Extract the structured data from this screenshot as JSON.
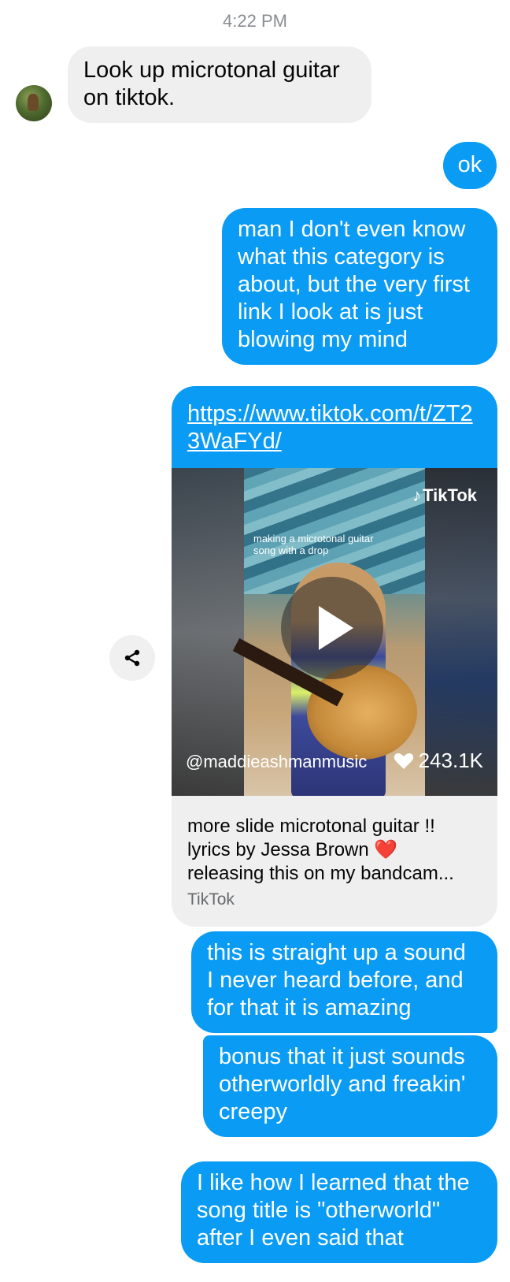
{
  "timestamp": "4:22 PM",
  "messages": {
    "m1": "Look up microtonal guitar\non tiktok.",
    "m2": "ok",
    "m3": "man I don't even know\nwhat this category is\nabout, but the very first\nlink I look at is just\nblowing my mind",
    "m5": "this is straight up a sound\nI never heard before, and\nfor that it is amazing",
    "m6": "bonus that it just sounds\notherworldly and freakin'\ncreepy",
    "m7": "I like how I learned that the\nsong title is \"otherworld\"\nafter I even said that"
  },
  "link_card": {
    "url": "https://www.tiktok.com/t/ZT23WaFYd/",
    "video_caption": "making a microtonal guitar\nsong with a drop",
    "logo_text": "TikTok",
    "handle": "@maddieashmanmusic",
    "likes": "243.1K",
    "title": "more slide microtonal guitar !!\nlyrics by Jessa Brown ❤️\nreleasing this on my bandcam...",
    "source": "TikTok"
  },
  "colors": {
    "outgoing_bubble": "#0a9bf5",
    "incoming_bubble": "#efefef"
  }
}
